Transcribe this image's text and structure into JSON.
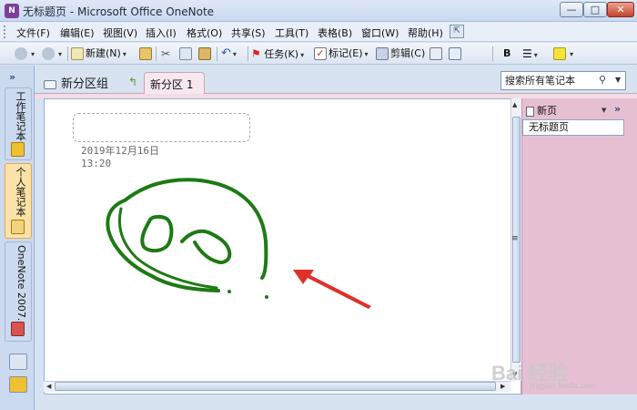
{
  "window": {
    "title": "无标题页 - Microsoft Office OneNote",
    "app_icon_glyph": "N",
    "minimize": "—",
    "maximize": "□",
    "close": "✕"
  },
  "menu": {
    "items": [
      "文件(F)",
      "编辑(E)",
      "视图(V)",
      "插入(I)",
      "格式(O)",
      "共享(S)",
      "工具(T)",
      "表格(B)",
      "窗口(W)",
      "帮助(H)"
    ]
  },
  "toolbar": {
    "new_label": "新建(N)",
    "task_label": "任务(K)",
    "flag_label": "标记(E)",
    "clip_label": "剪辑(C)",
    "bold_label": "B"
  },
  "tabs": {
    "section_group": "新分区组",
    "active_section": "新分区 1"
  },
  "search": {
    "placeholder": "搜索所有笔记本"
  },
  "notebooks": [
    {
      "label": "工作笔记本",
      "active": false
    },
    {
      "label": "个人笔记本",
      "active": true
    },
    {
      "label": "OneNote 2007...",
      "active": false
    }
  ],
  "leftbar": {
    "collapse": "»"
  },
  "page": {
    "date": "2019年12月16日",
    "time": "13:20"
  },
  "pagelist": {
    "new_page": "新页",
    "collapse": "»",
    "pages": [
      "无标题页"
    ]
  },
  "watermark": {
    "logo": "Bai 经验",
    "url": "jingyan.baidu.com"
  },
  "colors": {
    "ink": "#1e7a14",
    "arrow": "#e0302a",
    "section_tab": "#f7e8ef",
    "page_list": "#e7bfd3"
  }
}
